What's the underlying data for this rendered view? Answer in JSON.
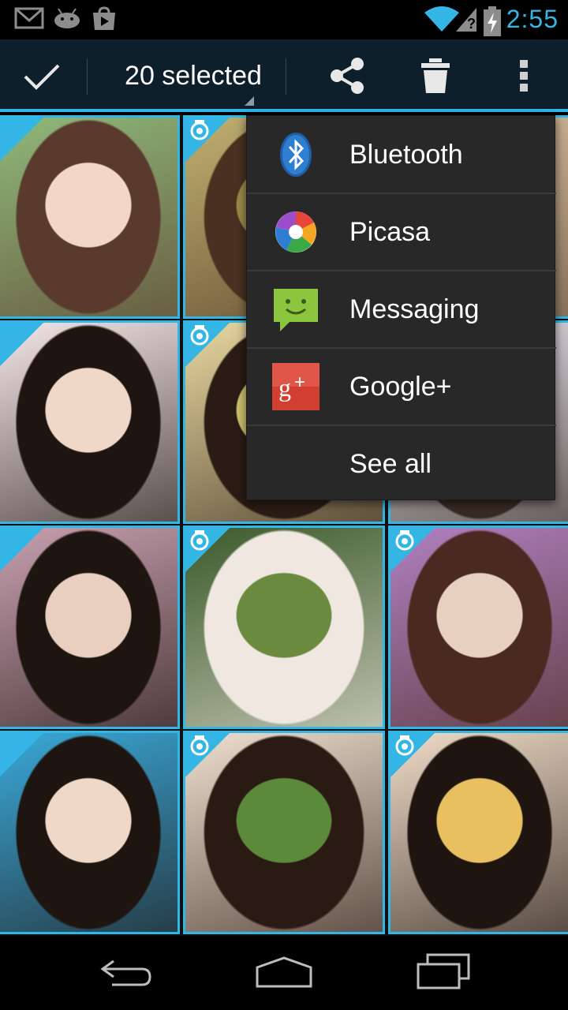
{
  "status_bar": {
    "time": "2:55",
    "icons": [
      "gmail-icon",
      "android-icon",
      "play-store-icon",
      "wifi-icon",
      "signal-icon",
      "battery-charging-icon"
    ]
  },
  "action_bar": {
    "done_icon": "checkmark-icon",
    "selection_label": "20 selected",
    "actions": [
      "share-icon",
      "delete-icon",
      "overflow-menu-icon"
    ]
  },
  "share_menu": {
    "items": [
      {
        "label": "Bluetooth",
        "icon": "bluetooth-icon"
      },
      {
        "label": "Picasa",
        "icon": "picasa-icon"
      },
      {
        "label": "Messaging",
        "icon": "messaging-icon"
      },
      {
        "label": "Google+",
        "icon": "google-plus-icon"
      },
      {
        "label": "See all",
        "icon": ""
      }
    ]
  },
  "grid": {
    "selected_count": 20,
    "selection_color": "#33b5e5",
    "photos": [
      {
        "name": "photo-1",
        "colors": [
          "#f2d6c8",
          "#5a3a2c",
          "#8fb97a"
        ]
      },
      {
        "name": "photo-2",
        "colors": [
          "#9a8a4a",
          "#4a3020",
          "#c0b070"
        ]
      },
      {
        "name": "photo-3",
        "colors": [
          "#b0a080",
          "#6a5040",
          "#d8c0a0"
        ]
      },
      {
        "name": "photo-4",
        "colors": [
          "#f0d8c8",
          "#1e1410",
          "#f5e6e8"
        ]
      },
      {
        "name": "photo-5",
        "colors": [
          "#d0c070",
          "#2a1c14",
          "#e8d8a0"
        ]
      },
      {
        "name": "photo-6",
        "colors": [
          "#c8d0d8",
          "#3a2a24",
          "#e8e8f0"
        ]
      },
      {
        "name": "photo-7",
        "colors": [
          "#e8cfc0",
          "#1e1410",
          "#c8a0b0"
        ]
      },
      {
        "name": "photo-8",
        "colors": [
          "#6a8a40",
          "#f0e8e0",
          "#3a5a2a"
        ]
      },
      {
        "name": "photo-9",
        "colors": [
          "#e8d0c0",
          "#4a2a20",
          "#b080c0"
        ]
      },
      {
        "name": "photo-10",
        "colors": [
          "#f0d8c8",
          "#1e1410",
          "#3aa8d8"
        ]
      },
      {
        "name": "photo-11",
        "colors": [
          "#5a8a3a",
          "#2a1a14",
          "#f0e0d0"
        ]
      },
      {
        "name": "photo-12",
        "colors": [
          "#e8c060",
          "#1e1410",
          "#f0dcc8"
        ]
      }
    ]
  },
  "nav_bar": {
    "buttons": [
      "back-icon",
      "home-icon",
      "recent-apps-icon"
    ]
  }
}
